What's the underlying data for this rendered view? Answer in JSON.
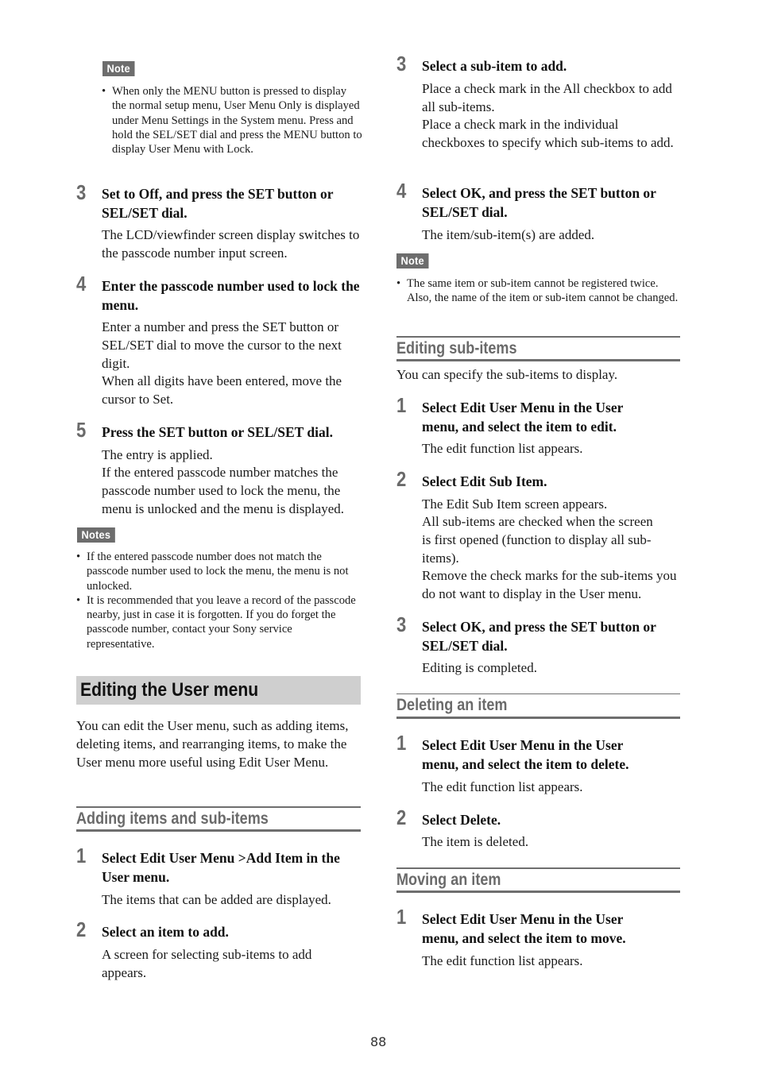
{
  "left": {
    "note1": {
      "label": "Note",
      "items": [
        "When only the MENU button is pressed to display the normal setup menu, User Menu Only is displayed under Menu Settings in the System menu. Press and hold the SEL/SET dial and press the MENU button to display User Menu with Lock."
      ]
    },
    "steps": [
      {
        "num": "3",
        "title": "Set to Off, and press the SET button or SEL/SET dial.",
        "body": [
          "The LCD/viewfinder screen display switches to the passcode number input screen."
        ]
      },
      {
        "num": "4",
        "title": "Enter the passcode number used to lock the menu.",
        "body": [
          "Enter a number and press the SET button or SEL/SET dial to move the cursor to the next digit.",
          "When all digits have been entered, move the cursor to Set."
        ]
      },
      {
        "num": "5",
        "title": "Press the SET button or SEL/SET dial.",
        "body": [
          "The entry is applied.",
          "If the entered passcode number matches the passcode number used to lock the menu, the menu is unlocked and the menu is displayed."
        ]
      }
    ],
    "notes2": {
      "label": "Notes",
      "items": [
        "If the entered passcode number does not match the passcode number used to lock the menu, the menu is not unlocked.",
        "It is recommended that you leave a record of the passcode nearby, just in case it is forgotten. If you do forget the passcode number, contact your Sony service representative."
      ]
    },
    "section_title": "Editing the User menu",
    "section_intro": "You can edit the User menu, such as adding items, deleting items, and rearranging items, to make the User menu more useful using Edit User Menu.",
    "adding": {
      "heading": "Adding items and sub-items",
      "steps": [
        {
          "num": "1",
          "title": "Select Edit User Menu >Add Item in the User menu.",
          "body": [
            "The items that can be added are displayed."
          ]
        },
        {
          "num": "2",
          "title": "Select an item to add.",
          "body": [
            "A screen for selecting sub-items to add appears."
          ]
        }
      ]
    }
  },
  "right": {
    "adding_cont": {
      "steps": [
        {
          "num": "3",
          "title": "Select a sub-item to add.",
          "body": [
            "Place a check mark in the All checkbox to add all sub-items.",
            "Place a check mark in the individual checkboxes to specify which sub-items to add."
          ]
        },
        {
          "num": "4",
          "title": "Select OK, and press the SET button or SEL/SET dial.",
          "body": [
            "The item/sub-item(s) are added."
          ]
        }
      ],
      "note": {
        "label": "Note",
        "items": [
          "The same item or sub-item cannot be registered twice. Also, the name of the item or sub-item cannot be changed."
        ]
      }
    },
    "editing_sub": {
      "heading": "Editing sub-items",
      "intro": "You can specify the sub-items to display.",
      "steps": [
        {
          "num": "1",
          "title": "Select Edit User Menu in the User menu, and select the item to edit.",
          "body": [
            "The edit function list appears."
          ]
        },
        {
          "num": "2",
          "title": "Select Edit Sub Item.",
          "body": [
            "The Edit Sub Item screen appears.",
            "All sub-items are checked when the screen is first opened (function to display all sub-items).",
            "Remove the check marks for the sub-items you do not want to display in the User menu."
          ]
        },
        {
          "num": "3",
          "title": "Select OK, and press the SET button or SEL/SET dial.",
          "body": [
            "Editing is completed."
          ]
        }
      ]
    },
    "deleting": {
      "heading": "Deleting an item",
      "steps": [
        {
          "num": "1",
          "title": "Select Edit User Menu in the User menu, and select the item to delete.",
          "body": [
            "The edit function list appears."
          ]
        },
        {
          "num": "2",
          "title": "Select Delete.",
          "body": [
            "The item is deleted."
          ]
        }
      ]
    },
    "moving": {
      "heading": "Moving an item",
      "steps": [
        {
          "num": "1",
          "title": "Select Edit User Menu in the User menu, and select the item to move.",
          "body": [
            "The edit function list appears."
          ]
        }
      ]
    }
  },
  "page_number": "88"
}
